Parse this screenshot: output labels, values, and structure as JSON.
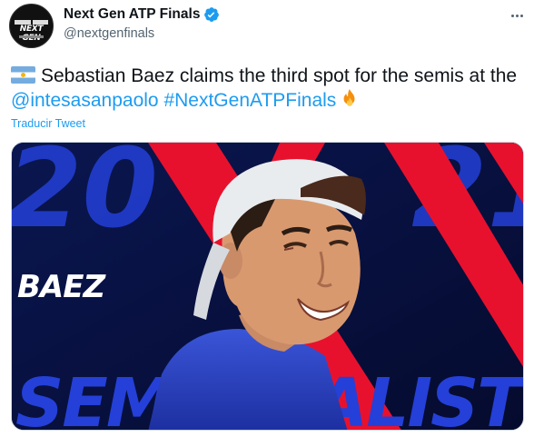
{
  "account": {
    "display_name": "Next Gen ATP Finals",
    "handle": "@nextgenfinals",
    "avatar_logo": "NEXT GEN"
  },
  "tweet": {
    "flag_icon": "argentina-flag-icon",
    "text_main": "Sebastian Baez claims the third spot for the semis at the ",
    "mention": "@intesasanpaolo",
    "hashtag": "#NextGenATPFinals",
    "emoji_icon": "fire-icon",
    "translate_label": "Traducir Tweet"
  },
  "media": {
    "year_left": "20",
    "year_right": "21",
    "player_name": "BAEZ",
    "banner_text": "SEMIFINALIST",
    "colors": {
      "background": "#07103c",
      "accent_red": "#e8112d",
      "accent_blue": "#2440d8"
    }
  },
  "colors": {
    "link": "#1d9bf0",
    "muted": "#536471",
    "verified": "#1d9bf0"
  }
}
